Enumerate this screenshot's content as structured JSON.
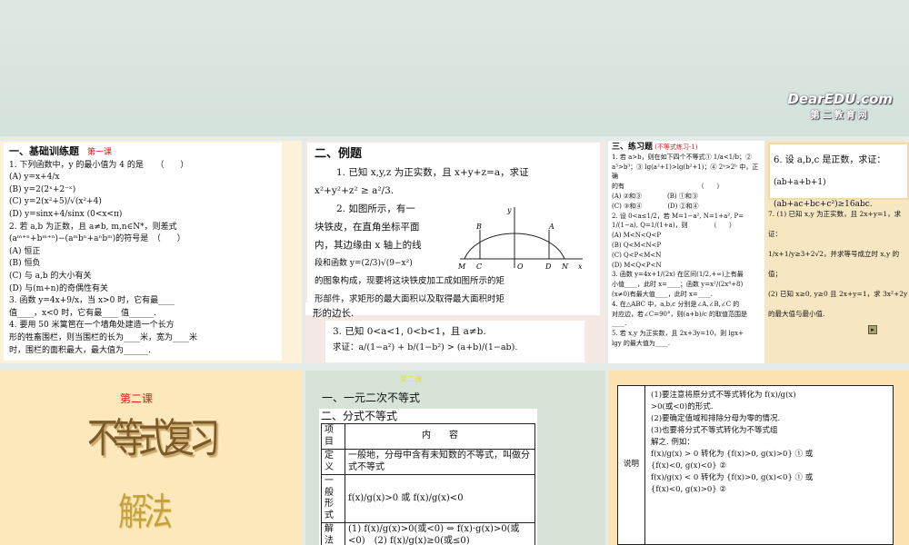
{
  "logo": {
    "text": "DearEDU.com",
    "sub": "第二教育网"
  },
  "slide1": {
    "title": "一、基础训练题",
    "tag": "第一课",
    "lines": [
      "1. 下列函数中，y 的最小值为 4 的是　　（　　）",
      "(A) y=x+4/x",
      "(B) y=2(2ˣ+2⁻ˣ)",
      "(C) y=2(x²+5)/√(x²+4)",
      "(D) y=sinx+4/sinx (0<x<π)",
      "2. 若 a,b 为正数，且 a≠b, m,n∈N*，则差式",
      "(aᵐ⁺ⁿ+bᵐ⁺ⁿ)−(aᵐbⁿ+aⁿbᵐ)的符号是　（　　）",
      "(A) 恒正",
      "(B) 恒负",
      "(C) 与 a,b 的大小有关",
      "(D) 与(m+n)的奇偶性有关",
      "3. 函数 y=4x+9/x，当 x>0 时，它有最____",
      "值____，x<0 时，它有最____ 值______.",
      "4. 要用 50 米篱笆在一个墙角处建造一个长方",
      "形的牲畜围栏，则当围栏的长为____米，宽为____米",
      "时，围栏的面积最大，最大值为______."
    ]
  },
  "slide2": {
    "title": "二、例题",
    "lines": [
      "1. 已知 x,y,z 为正实数，且 x+y+z=a，求证",
      "x²+y²+z² ≥ a²/3.",
      "2. 如图所示，有一",
      "块铁皮，在直角坐标平面",
      "内，其边缘由 x 轴上的线",
      "段和函数 y=(2/3)√(9−x²)",
      "的图象构成，现要将这块铁皮加工成如图所示的矩",
      "形部件，求矩形的最大面积以及取得最大面积时矩",
      "形的边长."
    ],
    "diagram_labels": [
      "y",
      "B",
      "A",
      "M",
      "C",
      "O",
      "D",
      "N",
      "x"
    ],
    "p3": [
      "3. 已知 0<a<1, 0<b<1，且 a≠b.",
      "求证：a/(1−a²) + b/(1−b²) > (a+b)/(1−ab)."
    ]
  },
  "slide3": {
    "title": "三、练习题",
    "tag": "(不等式练习-1)",
    "lines": [
      "1. 若 a>b，则在如下四个不等式① 1/a<1/b；②",
      "a³>b³；③ lg(a²+1)>lg(b²+1)；④ 2ᵃ>2ᵇ 中，正确",
      "的有　　　　　　　　　　　　（　　）",
      "(A) ②和③　　　　(B) ①和③",
      "(C) ③和④　　　　(D) ②和④",
      "2. 设 0<a≤1/2，若 M=1−a², N=1+a², P=",
      "1/(1−a), Q=1/(1+a)，则　　　　（　　）",
      "(A) M<N<Q<P",
      "(B) Q<M<N<P",
      "(C) Q<P<M<N",
      "(D) M<Q<P<N",
      "3. 函数 y=4x+1/(2x) 在区间(1/2,+∞)上有最",
      "小值____，此时 x=____；函数 y=x²/(2x⁴+8)",
      "(x≠0)有最大值____，此时 x=____.",
      "4. 在△ABC 中，a,b,c 分别是∠A,∠B,∠C 的",
      "对应边，若∠C=90°，则(a+b)/c 的取值范围是____.",
      "5. 若 x,y 为正实数，且 2x+3y=10，则 lgx+",
      "lgy 的最大值为____."
    ],
    "box": [
      "6. 设 a,b,c 是正数，求证：",
      "(ab+a+b+1)(ab+ac+bc+c²)≥16abc."
    ],
    "text": [
      "7. (1) 已知 x,y 为正实数，且 2x+y=1，求证：",
      "1/x+1/y≥3+2√2，并求等号成立时 x,y 的值；",
      "(2) 已知 x≥0, y≥0 且 2x+y=1，求 3x²+2y",
      "的最大值与最小值."
    ]
  },
  "slide4": {
    "tag": "第二课",
    "title": "不等式复习",
    "subtitle": "解法"
  },
  "slide5": {
    "tag": "第二课",
    "h1": "一、一元二次不等式",
    "h2": "二、分式不等式",
    "header": [
      "项目",
      "内　　容"
    ],
    "rows": [
      [
        "定义",
        "一般地，分母中含有未知数的不等式，叫做分式不等式"
      ],
      [
        "一般形式",
        "f(x)/g(x)>0 或 f(x)/g(x)<0"
      ],
      [
        "解法",
        "(1) f(x)/g(x)>0(或<0) ⇔ f(x)·g(x)>0(或<0)　(2) f(x)/g(x)≥0(或≤0)"
      ]
    ]
  },
  "slide6": {
    "label": "说明",
    "lines": [
      "(1)要注意将原分式不等式转化为 f(x)/g(x)",
      ">0(或<0)的形式.",
      "(2)要确定值域和排除分母为零的情况.",
      "(3)也要将分式不等式转化为不等式组",
      "解之. 例如：",
      "f(x)/g(x) > 0 转化为 {f(x)>0, g(x)>0} ① 或",
      "{f(x)<0, g(x)<0} ②",
      "f(x)/g(x) < 0 转化为 {f(x)>0, g(x)<0} ① 或",
      "{f(x)<0, g(x)>0} ②"
    ]
  }
}
